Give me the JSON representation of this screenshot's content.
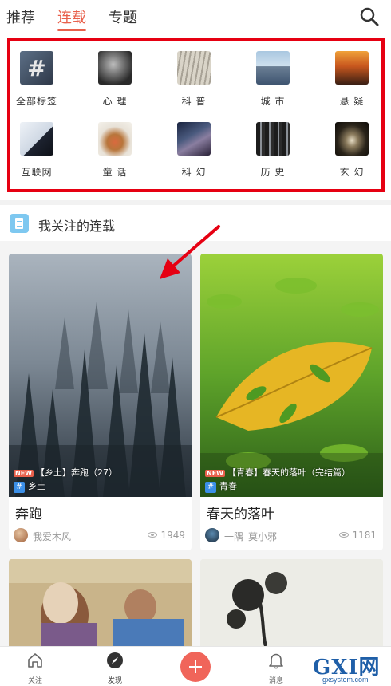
{
  "tabs": [
    {
      "label": "推荐",
      "active": false
    },
    {
      "label": "连载",
      "active": true
    },
    {
      "label": "专题",
      "active": false
    }
  ],
  "search_icon": "search-icon",
  "accent_color": "#e8604c",
  "categories": [
    {
      "label": "全部标签",
      "icon": "hash-icon"
    },
    {
      "label": "心 理",
      "icon": "psychology-thumb"
    },
    {
      "label": "科 普",
      "icon": "science-thumb"
    },
    {
      "label": "城 市",
      "icon": "city-thumb"
    },
    {
      "label": "悬 疑",
      "icon": "suspense-thumb"
    },
    {
      "label": "互联网",
      "icon": "internet-thumb"
    },
    {
      "label": "童 话",
      "icon": "fairy-tale-thumb"
    },
    {
      "label": "科 幻",
      "icon": "scifi-thumb"
    },
    {
      "label": "历 史",
      "icon": "history-thumb"
    },
    {
      "label": "玄 幻",
      "icon": "fantasy-thumb"
    }
  ],
  "follow": {
    "title": "我关注的连载",
    "icon": "document-icon"
  },
  "cards": [
    {
      "caption_line1": "【乡土】奔跑（27）",
      "badge_new": "NEW",
      "badge_hash": "#",
      "tag": "乡土",
      "title": "奔跑",
      "author": "我爱木风",
      "views": "1949"
    },
    {
      "caption_line1": "【青春】春天的落叶（完结篇）",
      "badge_new": "NEW",
      "badge_hash": "#",
      "tag": "青春",
      "title": "春天的落叶",
      "author": "一隅_莫小邪",
      "views": "1181"
    }
  ],
  "bottom_nav": [
    {
      "label": "关注",
      "icon": "home-icon"
    },
    {
      "label": "发现",
      "icon": "compass-icon"
    },
    {
      "label": "",
      "icon": "plus-icon"
    },
    {
      "label": "消息",
      "icon": "bell-icon"
    }
  ],
  "watermark": {
    "main": "GXI网",
    "sub": "gxsystem.com"
  }
}
